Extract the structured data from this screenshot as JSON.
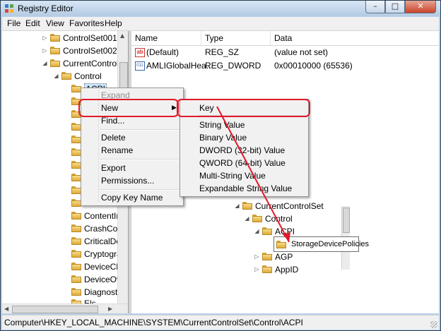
{
  "window": {
    "title": "Registry Editor",
    "controls": {
      "minimize": "–",
      "maximize": "□",
      "close": "✕"
    }
  },
  "menubar": [
    "File",
    "Edit",
    "View",
    "Favorites",
    "Help"
  ],
  "tree": {
    "top": [
      "ControlSet001",
      "ControlSet002",
      "CurrentControlSet",
      "Control",
      "ACPI"
    ],
    "bottom": [
      "ContentIn",
      "CrashContr",
      "CriticalDevi",
      "Cryptograp",
      "DeviceClas",
      "DeviceOve",
      "Diagnostic",
      "Els"
    ]
  },
  "list": {
    "columns": [
      "Name",
      "Type",
      "Data"
    ],
    "rows": [
      {
        "name": "(Default)",
        "type": "REG_SZ",
        "data": "(value not set)",
        "icon": "string-value-icon"
      },
      {
        "name": "AMLIGlobalHea...",
        "type": "REG_DWORD",
        "data": "0x00010000 (65536)",
        "icon": "binary-value-icon"
      }
    ]
  },
  "context_menu": {
    "items": [
      "Expand",
      "New",
      "Find...",
      "Delete",
      "Rename",
      "Export",
      "Permissions...",
      "Copy Key Name"
    ],
    "submenu_arrow": "▶"
  },
  "new_submenu": {
    "items": [
      "Key",
      "String Value",
      "Binary Value",
      "DWORD (32-bit) Value",
      "QWORD (64-bit) Value",
      "Multi-String Value",
      "Expandable String Value"
    ]
  },
  "inset": {
    "nodes": [
      "CurrentControlSet",
      "Control",
      "ACPI",
      "AGP",
      "AppID"
    ],
    "new_key": "StorageDevicePolicies"
  },
  "statusbar": {
    "path": "Computer\\HKEY_LOCAL_MACHINE\\SYSTEM\\CurrentControlSet\\Control\\ACPI"
  },
  "colors": {
    "highlight": "#e0192b",
    "titlebar": "#b9d1ea",
    "folder": "#f3cf6e"
  }
}
